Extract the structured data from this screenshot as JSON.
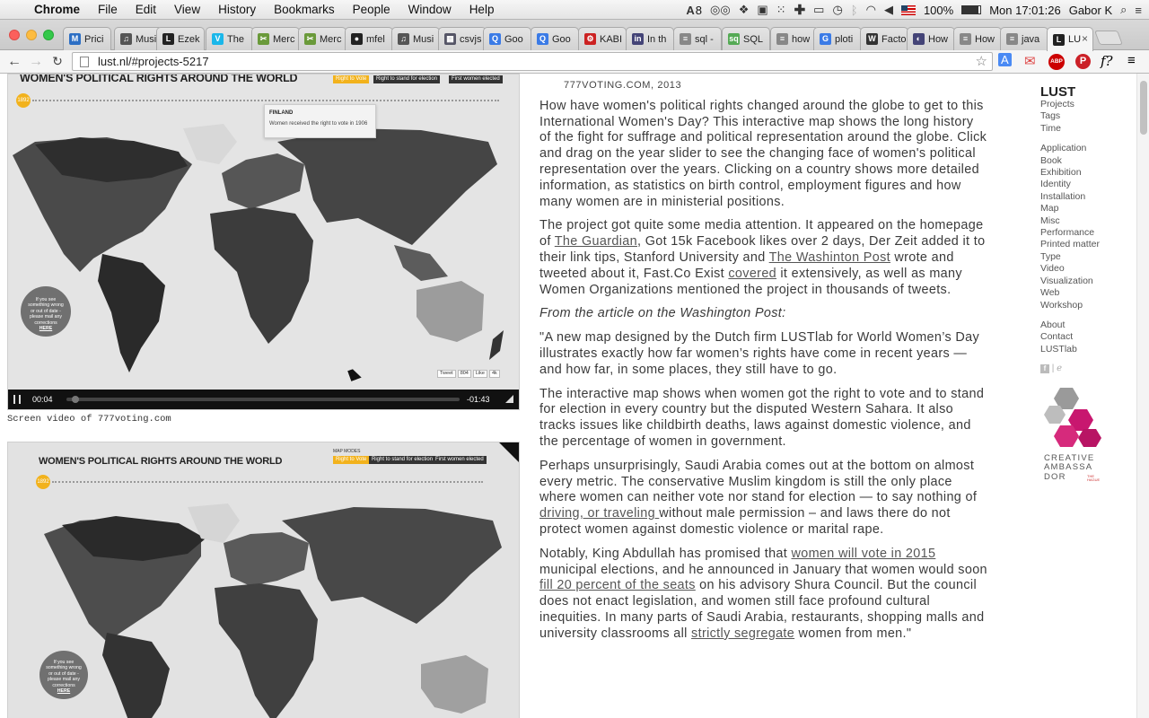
{
  "menubar": {
    "app": "Chrome",
    "items": [
      "File",
      "Edit",
      "View",
      "History",
      "Bookmarks",
      "People",
      "Window",
      "Help"
    ],
    "status": {
      "badge_count": "8",
      "battery": "100%",
      "datetime": "Mon 17:01:26",
      "user": "Gabor K"
    }
  },
  "tabs": [
    {
      "label": "Prici",
      "fav": "M",
      "color": "#2d6fc4"
    },
    {
      "label": "Musi",
      "fav": "♫",
      "color": "#555"
    },
    {
      "label": "Ezek",
      "fav": "L",
      "color": "#222"
    },
    {
      "label": "The",
      "fav": "V",
      "color": "#1ab7ea"
    },
    {
      "label": "Merc",
      "fav": "✂",
      "color": "#6a9a3a"
    },
    {
      "label": "Merc",
      "fav": "✂",
      "color": "#6a9a3a"
    },
    {
      "label": "mfel",
      "fav": "●",
      "color": "#222"
    },
    {
      "label": "Musi",
      "fav": "♫",
      "color": "#555"
    },
    {
      "label": "csvjs",
      "fav": "▦",
      "color": "#556"
    },
    {
      "label": "Goo",
      "fav": "Q",
      "color": "#3b7be6"
    },
    {
      "label": "Goo",
      "fav": "Q",
      "color": "#3b7be6"
    },
    {
      "label": "KABI",
      "fav": "⚙",
      "color": "#c22"
    },
    {
      "label": "In th",
      "fav": "in",
      "color": "#447"
    },
    {
      "label": "sql -",
      "fav": "≡",
      "color": "#888"
    },
    {
      "label": "SQL",
      "fav": "sq",
      "color": "#5a5"
    },
    {
      "label": "how",
      "fav": "≡",
      "color": "#888"
    },
    {
      "label": "ploti",
      "fav": "G",
      "color": "#3b7be6"
    },
    {
      "label": "Facto",
      "fav": "W",
      "color": "#333"
    },
    {
      "label": "How",
      "fav": "◐",
      "color": "#447"
    },
    {
      "label": "How",
      "fav": "≡",
      "color": "#888"
    },
    {
      "label": "java",
      "fav": "≡",
      "color": "#888"
    },
    {
      "label": "LU",
      "fav": "L",
      "color": "#222",
      "active": true
    }
  ],
  "toolbar": {
    "url": "lust.nl/#projects-5217"
  },
  "media1": {
    "title": "WOMEN'S POLITICAL RIGHTS AROUND THE WORLD",
    "modes": [
      "Right to Vote",
      "Right to stand for election",
      "First women elected"
    ],
    "year": "1892",
    "tooltip_country": "FINLAND",
    "tooltip_text": "Women received the right to vote in 1906",
    "feedback": [
      "If you see",
      "something wrong",
      "or out of date -",
      "please mail any",
      "corrections"
    ],
    "feedback_link": "HERE",
    "tweet": "Tweet",
    "tweet_count": "804",
    "like": "Like",
    "like_count": "4k",
    "time_current": "00:04",
    "time_remaining": "-01:43"
  },
  "caption": "Screen video of 777voting.com",
  "media2": {
    "title": "WOMEN'S POLITICAL RIGHTS AROUND THE WORLD",
    "modes_label": "MAP MODES",
    "modes": [
      "Right to Vote",
      "Right to stand for election",
      "First women elected"
    ],
    "year": "1892",
    "feedback": [
      "If you see",
      "something wrong",
      "or out of date -",
      "please mail any",
      "corrections"
    ],
    "feedback_link": "HERE"
  },
  "article": {
    "site": "777VOTING.COM, 2013",
    "p1": "How have women's political rights changed around the globe to get to this International Women's Day? This interactive map shows the long history of the fight for suffrage and political representation around the globe. Click and drag on the year slider to see the changing face of women's political representation over the years. Clicking on a country shows more detailed information, as statistics on birth control, employment figures and how many women are in ministerial positions.",
    "p2a": "The project got quite some media attention. It appeared on the homepage of ",
    "p2_link1": "The Guardian",
    "p2b": ", Got 15k Facebook likes over 2 days, Der Zeit added it to their link tips, Stanford University and ",
    "p2_link2": "The Washinton Post",
    "p2c": " wrote and tweeted about it, Fast.Co Exist ",
    "p2_link3": "covered",
    "p2d": " it extensively, as well as many Women Organizations mentioned the project in thousands of tweets.",
    "p3": "From the article on the Washington Post:",
    "p4": "\"A new map designed by the Dutch firm LUSTlab for World Women’s Day illustrates exactly how far women’s rights have come in recent years — and how far, in some places, they still have to go.",
    "p5": "The interactive map shows when women got the right to vote and to stand for election in every country but the disputed Western Sahara. It also tracks issues like childbirth deaths, laws against domestic violence, and the percentage of women in government.",
    "p6a": "Perhaps unsurprisingly, Saudi Arabia comes out at the bottom on almost every metric. The conservative Muslim kingdom is still the only place where women can neither vote nor stand for election — to say nothing of ",
    "p6_link": "driving, or traveling ",
    "p6b": "without male permission – and laws there do not protect women against domestic violence or marital rape.",
    "p7a": "Notably, King Abdullah has promised that ",
    "p7_link1": "women will vote in 2015",
    "p7b": " municipal elections, and he announced in January that women would soon ",
    "p7_link2": "fill 20 percent of the seats",
    "p7c": " on his advisory Shura Council. But the council does not enact legislation, and women still face profound cultural inequities. In many parts of Saudi Arabia, restaurants, shopping malls and university classrooms all ",
    "p7_link3": "strictly segregate",
    "p7d": " women from men.\""
  },
  "sidebar": {
    "logo": "LUST",
    "nav": [
      "Projects",
      "Tags",
      "Time"
    ],
    "categories": [
      "Application",
      "Book",
      "Exhibition",
      "Identity",
      "Installation",
      "Map",
      "Misc",
      "Performance",
      "Printed matter",
      "Type",
      "Video",
      "Visualization",
      "Web",
      "Workshop"
    ],
    "info": [
      "About",
      "Contact",
      "LUSTlab"
    ],
    "badge_lines": [
      "CREATIVE",
      "AMBASSA",
      "DOR"
    ],
    "badge_sub": [
      "THE",
      "HAGUE"
    ]
  }
}
